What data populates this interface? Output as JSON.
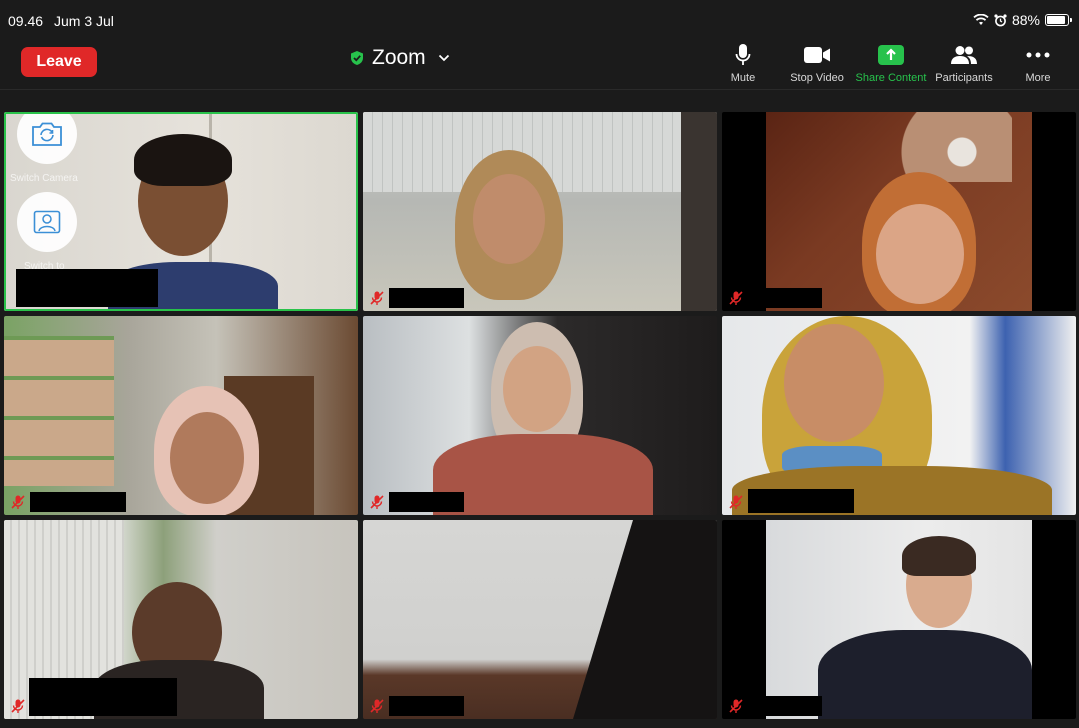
{
  "status_bar": {
    "time": "09.46",
    "date": "Jum 3 Jul",
    "battery": "88%",
    "battery_level": 0.88
  },
  "toolbar": {
    "leave_label": "Leave",
    "title": "Zoom",
    "controls": [
      {
        "label": "Mute",
        "icon": "microphone-icon"
      },
      {
        "label": "Stop Video",
        "icon": "video-camera-icon"
      },
      {
        "label": "Share Content",
        "icon": "share-arrow-icon"
      },
      {
        "label": "Participants",
        "icon": "participants-icon"
      },
      {
        "label": "More",
        "icon": "more-dots-icon"
      }
    ]
  },
  "overlay": {
    "switch_camera_label": "Switch Camera",
    "switch_to_label": "Switch to"
  },
  "colors": {
    "leave": "#e02828",
    "active_speaker": "#29c24a",
    "share": "#27c24c",
    "muted": "#e02828"
  }
}
